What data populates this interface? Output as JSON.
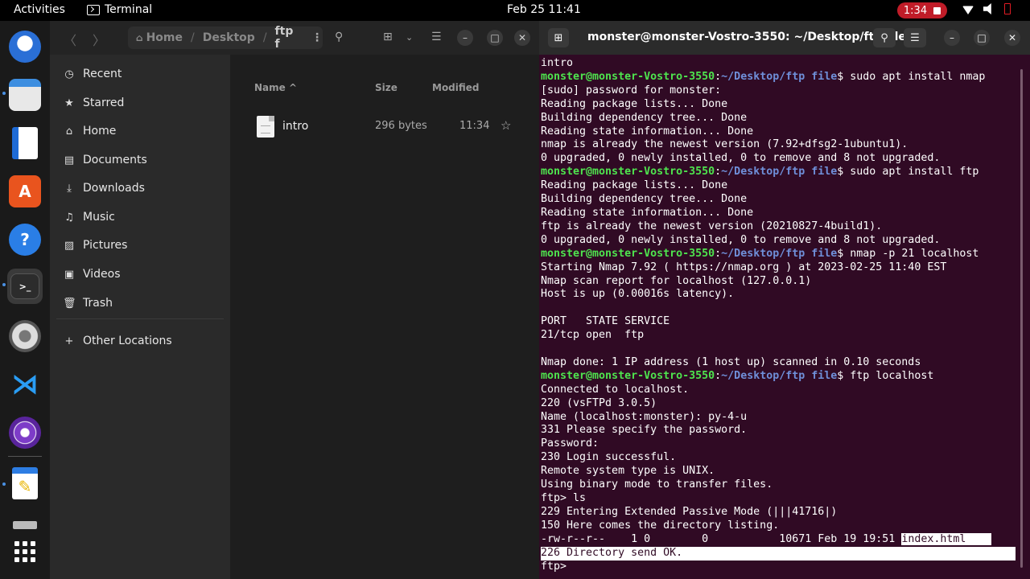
{
  "topbar": {
    "activities": "Activities",
    "app_name": "Terminal",
    "clock": "Feb 25  11:41",
    "recording_time": "1:34"
  },
  "dock": {
    "apps": [
      "thunderbird",
      "files",
      "libreoffice-writer",
      "software-center",
      "help",
      "terminal",
      "settings",
      "vscode",
      "tor-browser",
      "text-editor",
      "drive",
      "show-applications"
    ]
  },
  "files": {
    "path": [
      "Home",
      "Desktop",
      "ftp f"
    ],
    "sidebar": [
      {
        "label": "Recent",
        "icon": "clock-icon"
      },
      {
        "label": "Starred",
        "icon": "star-icon"
      },
      {
        "label": "Home",
        "icon": "home-icon"
      },
      {
        "label": "Documents",
        "icon": "document-icon"
      },
      {
        "label": "Downloads",
        "icon": "download-icon"
      },
      {
        "label": "Music",
        "icon": "music-icon"
      },
      {
        "label": "Pictures",
        "icon": "picture-icon"
      },
      {
        "label": "Videos",
        "icon": "video-icon"
      },
      {
        "label": "Trash",
        "icon": "trash-icon"
      }
    ],
    "other_locations": "Other Locations",
    "columns": {
      "name": "Name",
      "size": "Size",
      "modified": "Modified"
    },
    "rows": [
      {
        "name": "intro",
        "size": "296 bytes",
        "modified": "11:34"
      }
    ]
  },
  "terminal": {
    "title": "monster@monster-Vostro-3550: ~/Desktop/ftp file",
    "user_host": "monster@monster-Vostro-3550",
    "cwd": "~/Desktop/ftp file",
    "lines": [
      {
        "t": "out",
        "text": "intro"
      },
      {
        "t": "cmd",
        "text": "sudo apt install nmap"
      },
      {
        "t": "out",
        "text": "[sudo] password for monster:"
      },
      {
        "t": "out",
        "text": "Reading package lists... Done"
      },
      {
        "t": "out",
        "text": "Building dependency tree... Done"
      },
      {
        "t": "out",
        "text": "Reading state information... Done"
      },
      {
        "t": "out",
        "text": "nmap is already the newest version (7.92+dfsg2-1ubuntu1)."
      },
      {
        "t": "out",
        "text": "0 upgraded, 0 newly installed, 0 to remove and 8 not upgraded."
      },
      {
        "t": "cmd",
        "text": "sudo apt install ftp"
      },
      {
        "t": "out",
        "text": "Reading package lists... Done"
      },
      {
        "t": "out",
        "text": "Building dependency tree... Done"
      },
      {
        "t": "out",
        "text": "Reading state information... Done"
      },
      {
        "t": "out",
        "text": "ftp is already the newest version (20210827-4build1)."
      },
      {
        "t": "out",
        "text": "0 upgraded, 0 newly installed, 0 to remove and 8 not upgraded."
      },
      {
        "t": "cmd",
        "text": "nmap -p 21 localhost"
      },
      {
        "t": "out",
        "text": "Starting Nmap 7.92 ( https://nmap.org ) at 2023-02-25 11:40 EST"
      },
      {
        "t": "out",
        "text": "Nmap scan report for localhost (127.0.0.1)"
      },
      {
        "t": "out",
        "text": "Host is up (0.00016s latency)."
      },
      {
        "t": "out",
        "text": ""
      },
      {
        "t": "out",
        "text": "PORT   STATE SERVICE"
      },
      {
        "t": "out",
        "text": "21/tcp open  ftp"
      },
      {
        "t": "out",
        "text": ""
      },
      {
        "t": "out",
        "text": "Nmap done: 1 IP address (1 host up) scanned in 0.10 seconds"
      },
      {
        "t": "cmd",
        "text": "ftp localhost"
      },
      {
        "t": "out",
        "text": "Connected to localhost."
      },
      {
        "t": "out",
        "text": "220 (vsFTPd 3.0.5)"
      },
      {
        "t": "out",
        "text": "Name (localhost:monster): py-4-u"
      },
      {
        "t": "out",
        "text": "331 Please specify the password."
      },
      {
        "t": "out",
        "text": "Password:"
      },
      {
        "t": "out",
        "text": "230 Login successful."
      },
      {
        "t": "out",
        "text": "Remote system type is UNIX."
      },
      {
        "t": "out",
        "text": "Using binary mode to transfer files."
      },
      {
        "t": "out",
        "text": "ftp> ls"
      },
      {
        "t": "out",
        "text": "229 Entering Extended Passive Mode (|||41716|)"
      },
      {
        "t": "out",
        "text": "150 Here comes the directory listing."
      },
      {
        "t": "hl1",
        "text": "-rw-r--r--    1 0        0           10671 Feb 19 19:51 ",
        "hl": "index.html"
      },
      {
        "t": "hl2",
        "text": "226 Directory send OK."
      },
      {
        "t": "out",
        "text": "ftp> "
      }
    ]
  }
}
